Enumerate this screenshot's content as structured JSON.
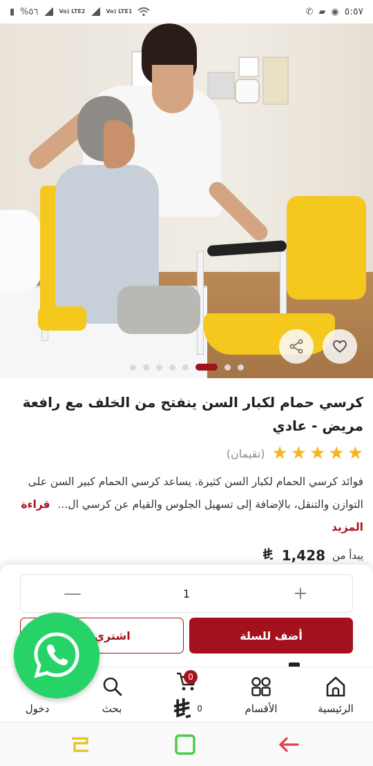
{
  "status_bar": {
    "battery": "%٥٦",
    "lte1": "Vo) LTE2",
    "lte2": "Vo) LTE1",
    "time": "٥:٥٧"
  },
  "product": {
    "title": "كرسي حمام لكبار السن ينفتح من الخلف مع رافعة مريض - عادي",
    "stars": 5,
    "rating_label": "(تقيمان)",
    "description": "فوائد كرسي الحمام لكبار السن كثيرة. يساعد كرسي الحمام كبير السن على التوازن والتنقل، بالإضافة إلى تسهيل الجلوس والقيام عن كرسي ال...",
    "read_more": "قراءة المزيد",
    "starts_from": "يبدأ من",
    "price": "1,428",
    "currency_symbol": "⃁"
  },
  "carousel": {
    "total_slides": 8,
    "active_index": 5
  },
  "quantity": {
    "value": "1",
    "minus": "—",
    "plus": "+"
  },
  "actions": {
    "add_to_cart": "أضف للسلة",
    "buy_now": "اشتري"
  },
  "nav": {
    "home": "الرئيسية",
    "categories": "الأقسام",
    "cart_badge": "0",
    "cart_total": "0",
    "search": "بحث",
    "login": "دخول"
  },
  "icons": {
    "share": "share-icon",
    "favorite": "heart-icon",
    "whatsapp": "whatsapp-icon",
    "home": "home-icon",
    "categories": "grid-icon",
    "cart": "cart-icon",
    "search": "search-icon"
  },
  "colors": {
    "brand": "#a3121c",
    "star": "#f6b51c",
    "whatsapp": "#25d366"
  }
}
